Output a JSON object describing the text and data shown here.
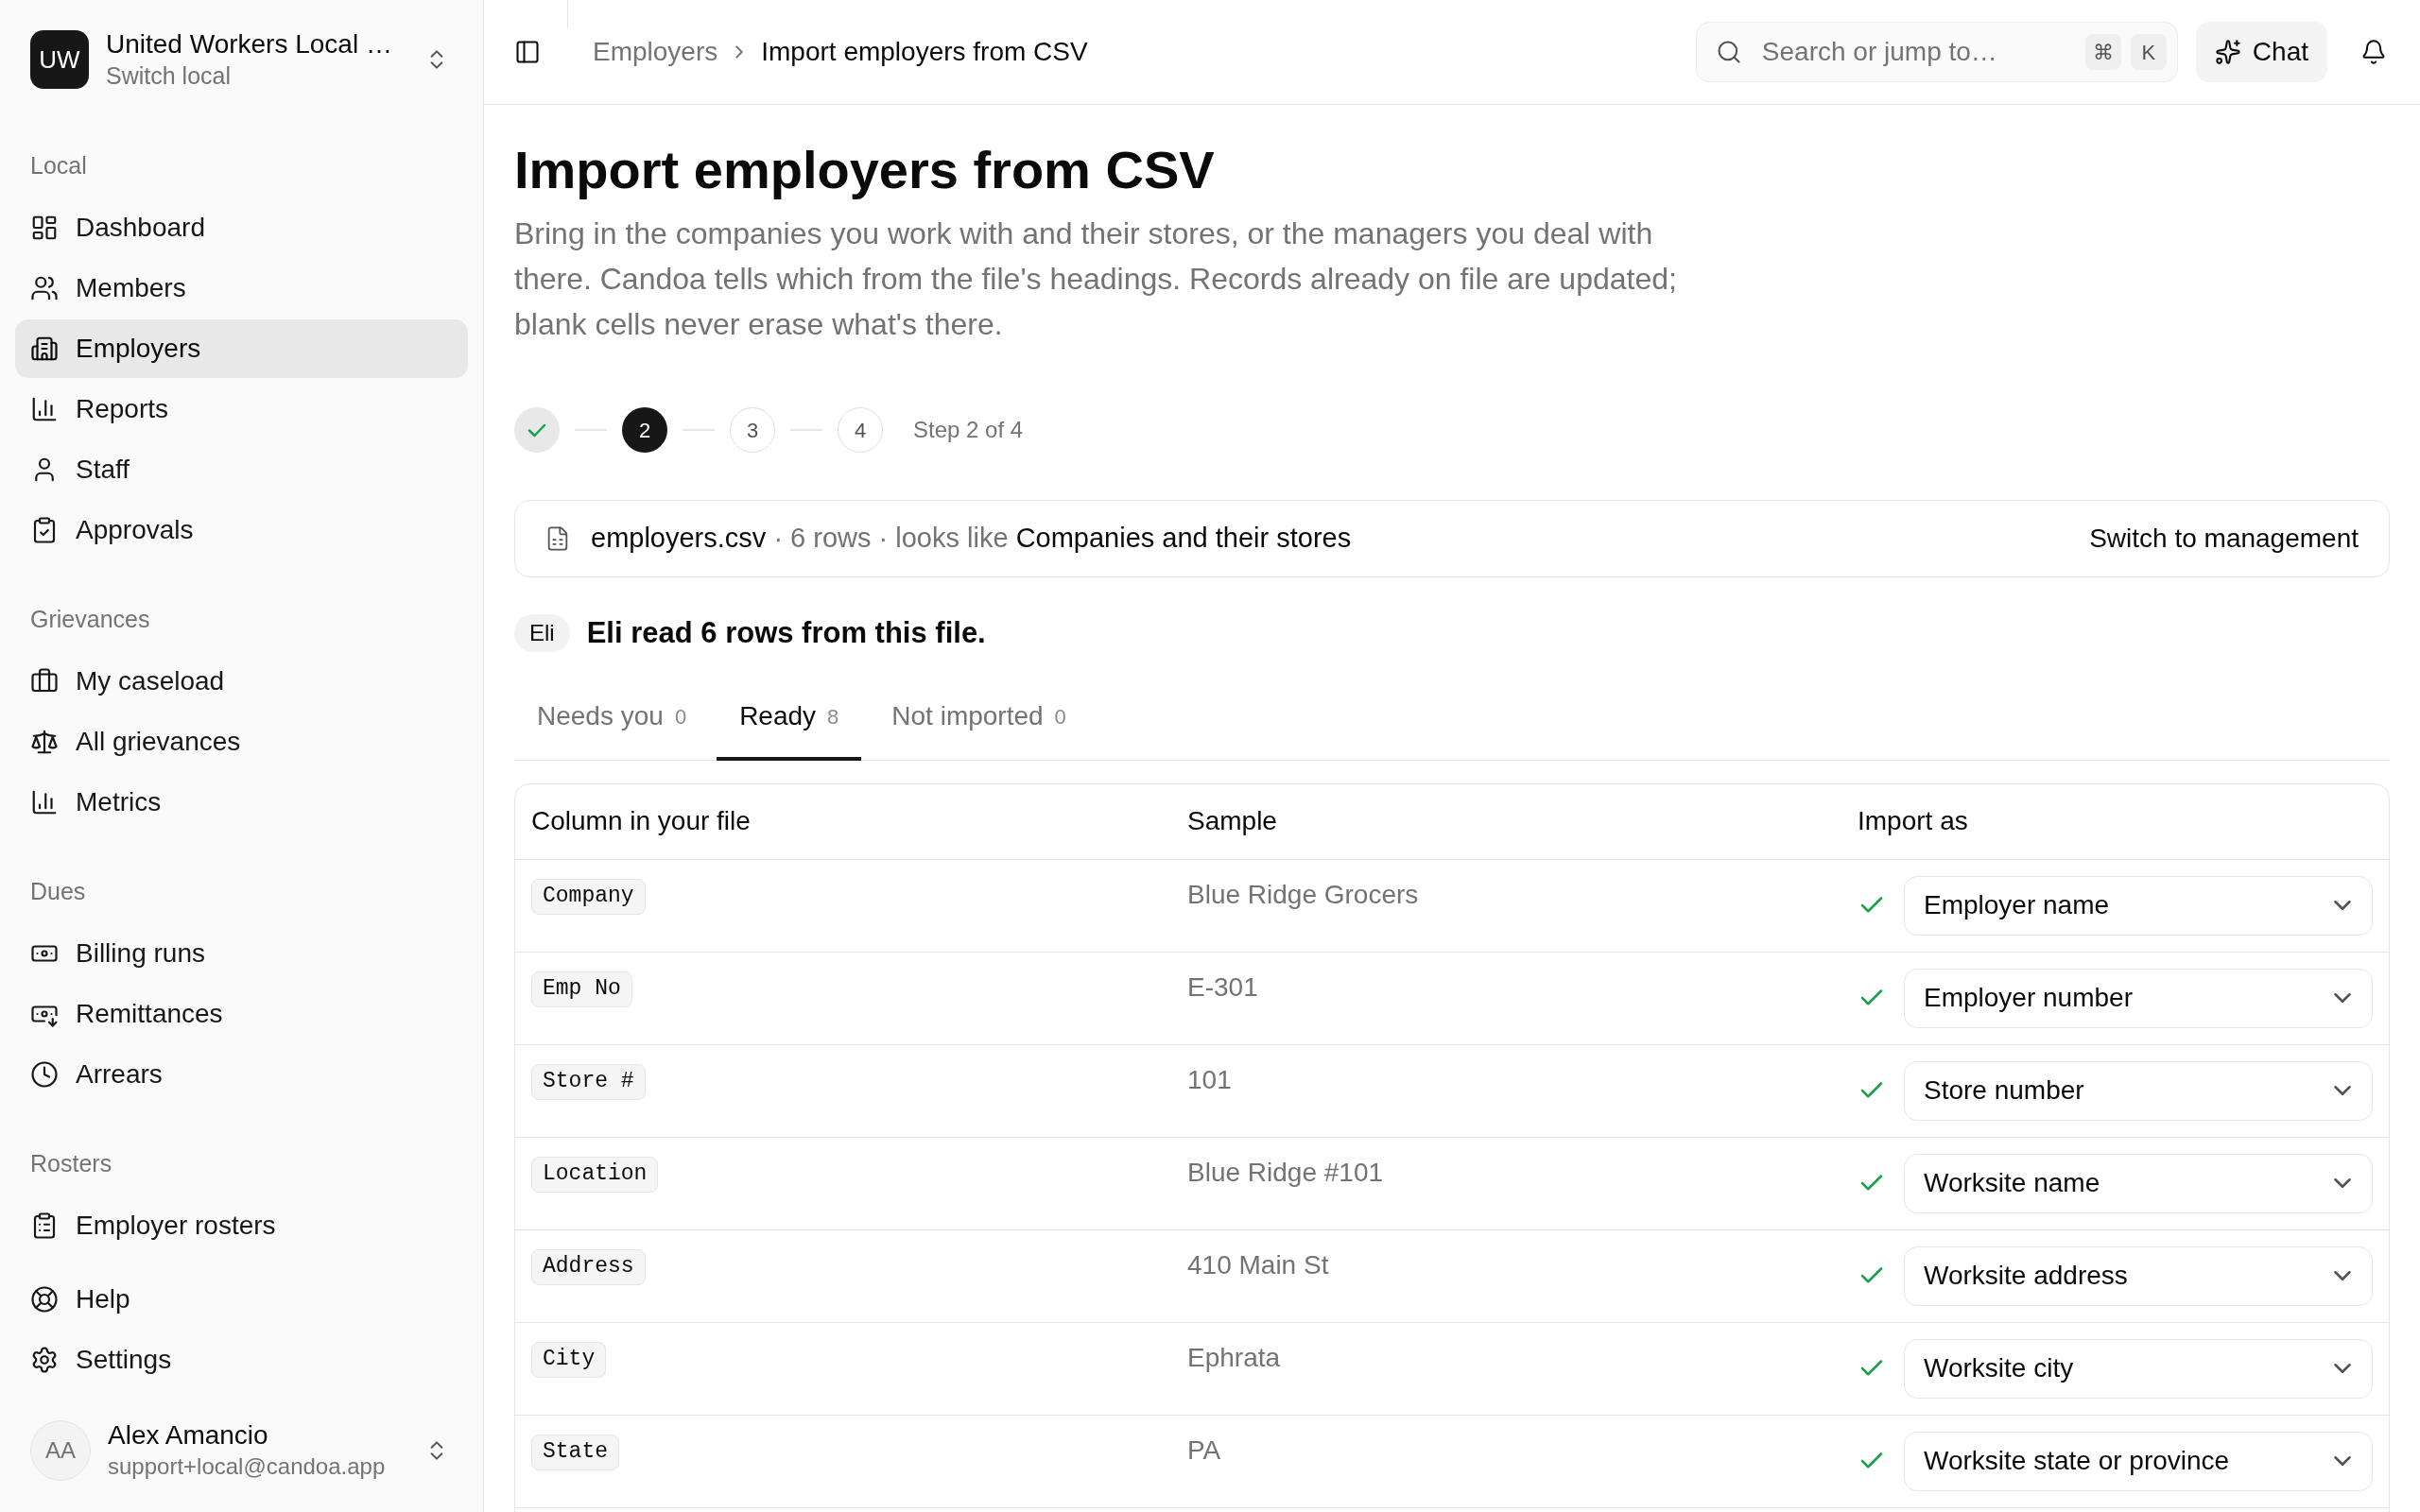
{
  "sidebar": {
    "workspace": {
      "initials": "UW",
      "name": "United Workers Local …",
      "subtitle": "Switch local"
    },
    "sections": [
      {
        "label": "Local",
        "items": [
          {
            "label": "Dashboard",
            "selected": false
          },
          {
            "label": "Members",
            "selected": false
          },
          {
            "label": "Employers",
            "selected": true
          },
          {
            "label": "Reports",
            "selected": false
          },
          {
            "label": "Staff",
            "selected": false
          },
          {
            "label": "Approvals",
            "selected": false
          }
        ]
      },
      {
        "label": "Grievances",
        "items": [
          {
            "label": "My caseload",
            "selected": false
          },
          {
            "label": "All grievances",
            "selected": false
          },
          {
            "label": "Metrics",
            "selected": false
          }
        ]
      },
      {
        "label": "Dues",
        "items": [
          {
            "label": "Billing runs",
            "selected": false
          },
          {
            "label": "Remittances",
            "selected": false
          },
          {
            "label": "Arrears",
            "selected": false
          }
        ]
      },
      {
        "label": "Rosters",
        "items": [
          {
            "label": "Employer rosters",
            "selected": false
          }
        ]
      }
    ],
    "footer_items": [
      {
        "label": "Help",
        "selected": false
      },
      {
        "label": "Settings",
        "selected": false
      }
    ],
    "user": {
      "initials": "AA",
      "name": "Alex Amancio",
      "email": "support+local@candoa.app"
    }
  },
  "header": {
    "breadcrumbs": [
      {
        "label": "Employers"
      },
      {
        "label": "Import employers from CSV"
      }
    ],
    "search": {
      "placeholder": "Search or jump to…",
      "shortcut_keys": [
        "⌘",
        "K"
      ]
    },
    "chat_button": "Chat"
  },
  "page": {
    "title": "Import employers from CSV",
    "description": "Bring in the companies you work with and their stores, or the managers you deal with there. Candoa tells which from the file's headings. Records already on file are updated; blank cells never erase what's there.",
    "stepper": {
      "steps": [
        {
          "done": true,
          "current": false
        },
        {
          "done": false,
          "current": true,
          "label": "2"
        },
        {
          "done": false,
          "current": false,
          "label": "3"
        },
        {
          "done": false,
          "current": false,
          "label": "4"
        }
      ],
      "caption": "Step 2 of 4"
    },
    "file_summary": {
      "text": "**employers.csv** · 6 rows · looks like **Companies and their stores**",
      "switch_button": "Switch to management"
    },
    "assistant": {
      "badge": "Eli",
      "message": "Eli read 6 rows from this file."
    },
    "tabs": [
      {
        "label": "Needs you",
        "count": "0",
        "selected": false
      },
      {
        "label": "Ready",
        "count": "8",
        "selected": true
      },
      {
        "label": "Not imported",
        "count": "0",
        "selected": false
      }
    ],
    "table": {
      "columns": [
        "Column in your file",
        "Sample",
        "Import as"
      ],
      "rows": [
        {
          "column": "Company",
          "sample": "Blue Ridge Grocers",
          "matched": true,
          "import_as": "Employer name"
        },
        {
          "column": "Emp No",
          "sample": "E-301",
          "matched": true,
          "import_as": "Employer number"
        },
        {
          "column": "Store #",
          "sample": "101",
          "matched": true,
          "import_as": "Store number"
        },
        {
          "column": "Location",
          "sample": "Blue Ridge #101",
          "matched": true,
          "import_as": "Worksite name"
        },
        {
          "column": "Address",
          "sample": "410 Main St",
          "matched": true,
          "import_as": "Worksite address"
        },
        {
          "column": "City",
          "sample": "Ephrata",
          "matched": true,
          "import_as": "Worksite city"
        },
        {
          "column": "State",
          "sample": "PA",
          "matched": true,
          "import_as": "Worksite state or province"
        }
      ]
    }
  }
}
